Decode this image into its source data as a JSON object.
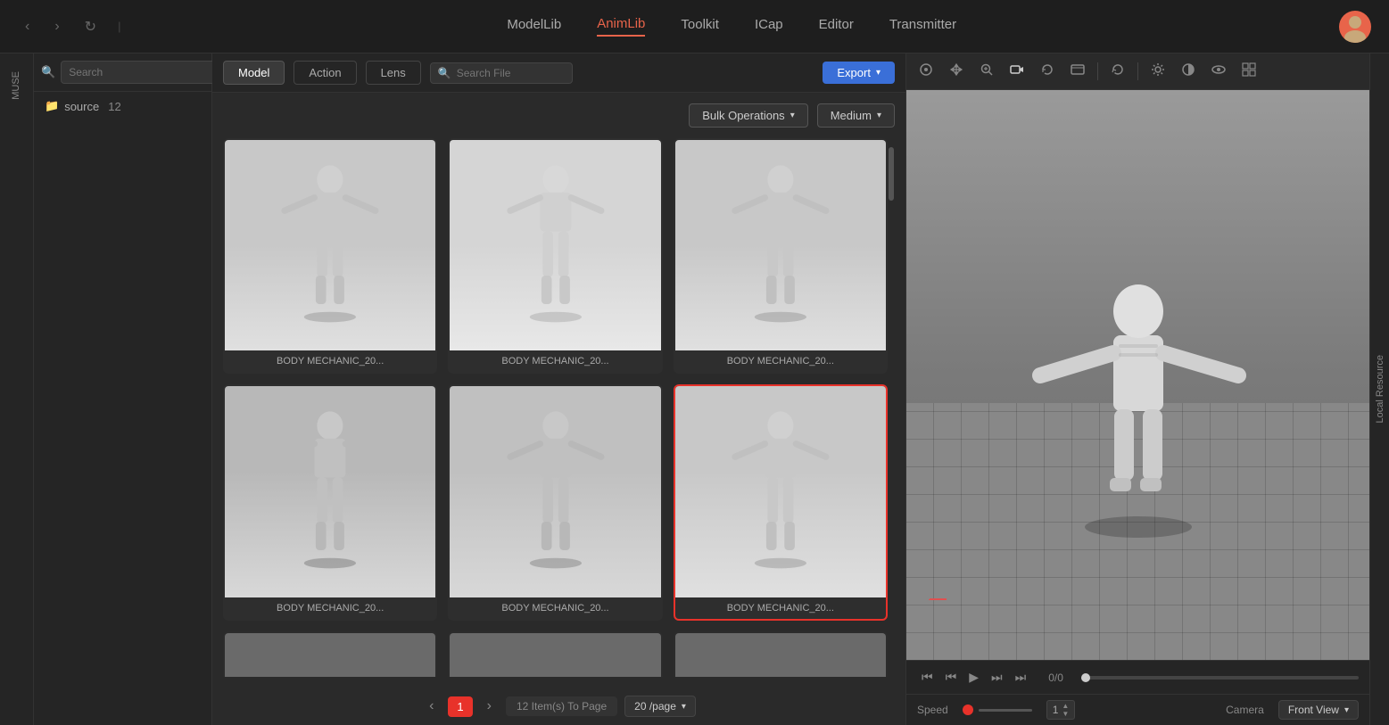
{
  "app": {
    "title": "AnimLib"
  },
  "topbar": {
    "nav_items": [
      {
        "label": "ModelLib",
        "active": false
      },
      {
        "label": "AnimLib",
        "active": true
      },
      {
        "label": "Toolkit",
        "active": false
      },
      {
        "label": "ICap",
        "active": false
      },
      {
        "label": "Editor",
        "active": false
      },
      {
        "label": "Transmitter",
        "active": false
      }
    ],
    "back_arrow": "‹",
    "forward_arrow": "›",
    "refresh": "↻"
  },
  "sidebar": {
    "muse_label": "MUSE",
    "local_resource_label": "Local Resource"
  },
  "file_panel": {
    "search_placeholder": "Search",
    "collapse_icon": "◄",
    "folder": {
      "icon": "📁",
      "name": "source",
      "count": "12"
    }
  },
  "content": {
    "tabs": [
      {
        "label": "Model",
        "active": true
      },
      {
        "label": "Action",
        "active": false
      },
      {
        "label": "Lens",
        "active": false
      }
    ],
    "search_placeholder": "Search File",
    "export_label": "Export",
    "bulk_operations_label": "Bulk Operations",
    "medium_label": "Medium",
    "grid_items": [
      {
        "id": 1,
        "label": "BODY MECHANIC_20...",
        "selected": false,
        "row": 1
      },
      {
        "id": 2,
        "label": "BODY MECHANIC_20...",
        "selected": false,
        "row": 1
      },
      {
        "id": 3,
        "label": "BODY MECHANIC_20...",
        "selected": false,
        "row": 1
      },
      {
        "id": 4,
        "label": "BODY MECHANIC_20...",
        "selected": false,
        "row": 2
      },
      {
        "id": 5,
        "label": "BODY MECHANIC_20...",
        "selected": false,
        "row": 2
      },
      {
        "id": 6,
        "label": "BODY MECHANIC_20...",
        "selected": true,
        "row": 2
      },
      {
        "id": 7,
        "label": "",
        "selected": false,
        "row": 3
      },
      {
        "id": 8,
        "label": "",
        "selected": false,
        "row": 3
      },
      {
        "id": 9,
        "label": "",
        "selected": false,
        "row": 3
      }
    ],
    "pagination": {
      "prev_arrow": "‹",
      "next_arrow": "›",
      "current_page": "1",
      "page_info": "12 Item(s) To Page",
      "per_page": "20 /page"
    }
  },
  "viewport": {
    "toolbar_icons": [
      "target",
      "move",
      "zoom-in",
      "camera",
      "rotate",
      "video",
      "arrow-right",
      "refresh",
      "sun",
      "contrast",
      "eye",
      "grid"
    ],
    "frame_display": "0/0",
    "playback": {
      "skip_start": "⏮",
      "prev_frame": "⏪",
      "play": "▶",
      "next_frame": "⏩",
      "skip_end": "⏭"
    },
    "speed_label": "Speed",
    "speed_value": "1",
    "camera_label": "Camera",
    "camera_view": "Front View"
  },
  "colors": {
    "accent": "#e8322a",
    "brand_blue": "#3a6fd8",
    "active_tab_underline": "#e8644a"
  }
}
